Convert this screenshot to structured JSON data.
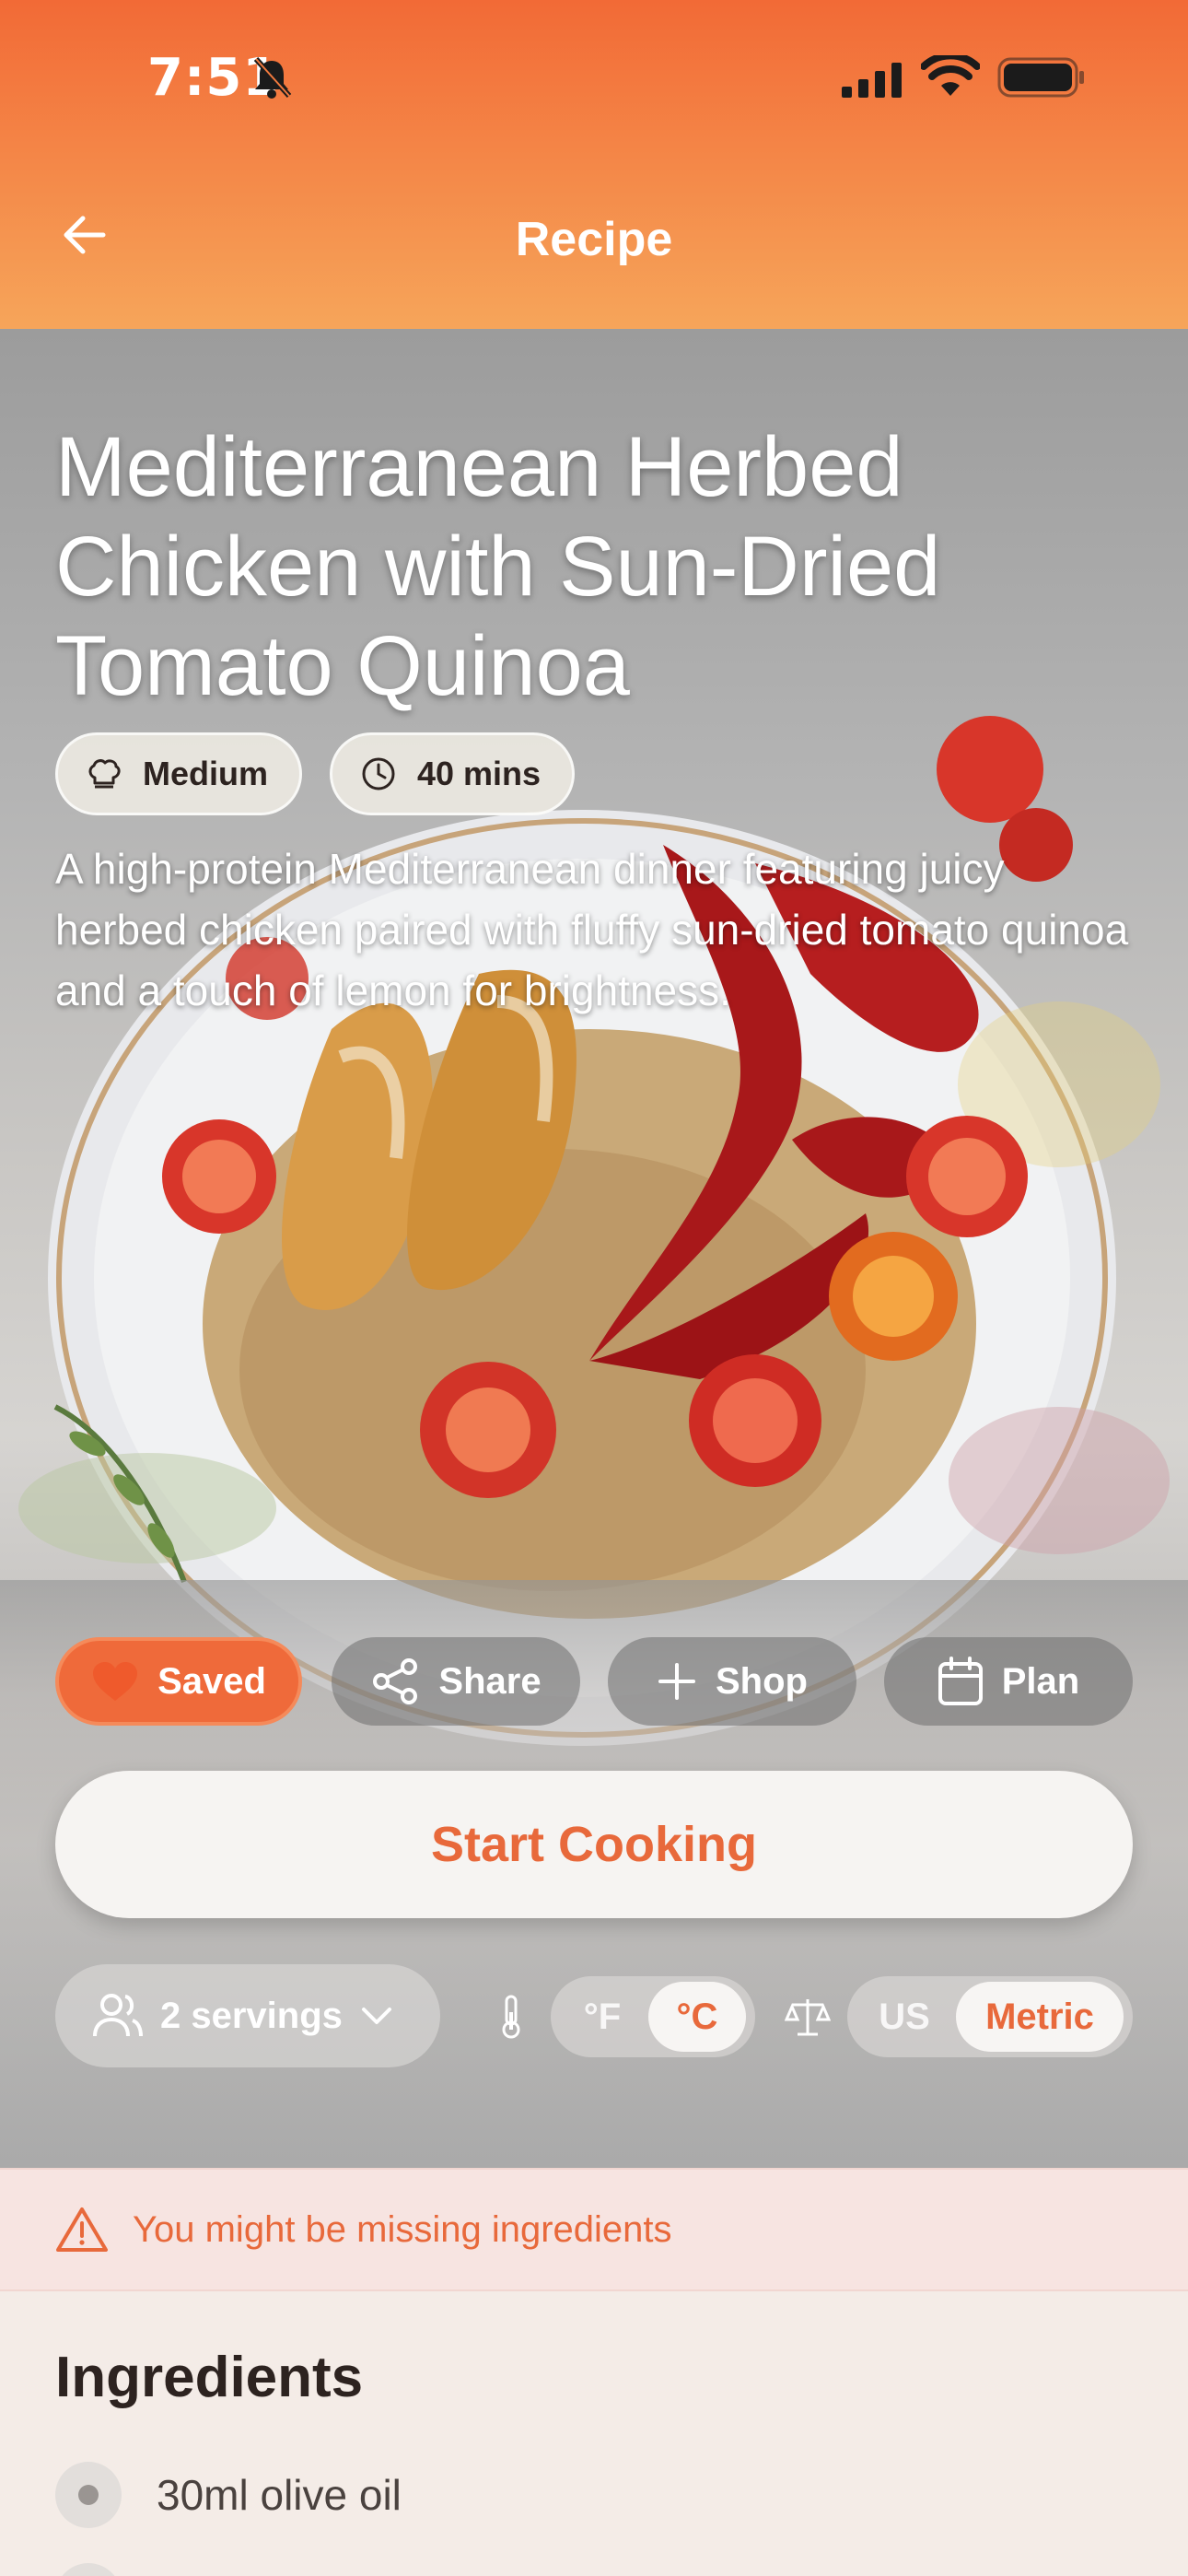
{
  "status_bar": {
    "time": "7:51"
  },
  "nav": {
    "title": "Recipe"
  },
  "recipe": {
    "title": "Mediterranean Herbed Chicken with Sun-Dried Tomato Quinoa",
    "difficulty": "Medium",
    "time": "40 mins",
    "description": "A high-protein Mediterranean dinner featuring juicy herbed chicken paired with fluffy sun-dried tomato quinoa and a touch of lemon for brightness."
  },
  "actions": {
    "saved": "Saved",
    "share": "Share",
    "shop": "Shop",
    "plan": "Plan",
    "start_cooking": "Start Cooking"
  },
  "settings": {
    "servings": "2 servings",
    "temp_f": "°F",
    "temp_c": "°C",
    "unit_us": "US",
    "unit_metric": "Metric"
  },
  "warning": "You might be missing ingredients",
  "ingredients": {
    "title": "Ingredients",
    "items": [
      "30ml olive oil"
    ]
  },
  "colors": {
    "accent": "#e8693b",
    "header_top": "#f26a36",
    "header_bottom": "#f6a55a"
  }
}
